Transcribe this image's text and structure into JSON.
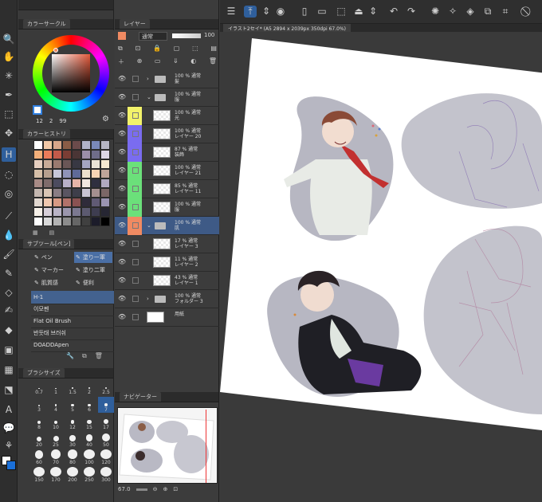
{
  "toolbar": {
    "icons": [
      "zoom-icon",
      "hand-icon",
      "sparkle-icon",
      "eyedropper-icon",
      "select-icon",
      "move-icon",
      "pen-icon",
      "lasso-icon",
      "spiral-icon",
      "dropper-icon",
      "blend-icon",
      "brush-icon",
      "eraser-icon",
      "pen2-icon",
      "fill-icon",
      "gradient-icon",
      "frame-icon",
      "shape-icon",
      "text-icon",
      "balloon-icon",
      "correct-icon"
    ]
  },
  "color_panel": {
    "title": "カラーサークル",
    "values": [
      "12",
      "2",
      "99"
    ],
    "main_color": "#f08a62",
    "sub_color": "#ffffff"
  },
  "history_panel": {
    "title": "カラーヒストリ",
    "swatches": [
      "#ffffff",
      "#f2c9a8",
      "#d8a78a",
      "#8a5d46",
      "#6b4b4b",
      "#b0b3c8",
      "#7a89b9",
      "#b7b6c4",
      "#f4b07a",
      "#ec7c5a",
      "#c25a4a",
      "#7a3d34",
      "#4a3535",
      "#9b8fa8",
      "#6f6d8a",
      "#dcd6e6",
      "#e6cfc0",
      "#c8aa98",
      "#9a7a70",
      "#6a5656",
      "#383843",
      "#a4a6c2",
      "#e9e3d6",
      "#f5e8d0",
      "#d6bfa8",
      "#b69f8e",
      "#c6c6d8",
      "#8f93b8",
      "#5f6a98",
      "#ece0cc",
      "#f7d4b4",
      "#bfa49a",
      "#a88b86",
      "#7f6b6b",
      "#4c4b5f",
      "#b8b0c9",
      "#e6b4a8",
      "#f2e7e0",
      "#2f2f3f",
      "#b1a9c0",
      "#c4b7b0",
      "#d9c5b5",
      "#8a7d84",
      "#5a5562",
      "#3e3e4a",
      "#c9c4d2",
      "#a48f8f",
      "#7b6767",
      "#e2d8d0",
      "#f0c8b0",
      "#d89a84",
      "#b2726a",
      "#8a5252",
      "#2f2b3a",
      "#605a74",
      "#9a94b2",
      "#f6f0e8",
      "#d7cfd8",
      "#bab4c6",
      "#9b96ad",
      "#7b7890",
      "#5c5a70",
      "#3e3d50",
      "#262633",
      "#ffffff",
      "#d9d9d9",
      "#b3b3b3",
      "#8c8c8c",
      "#666666",
      "#404040",
      "#1c1c2a",
      "#000000"
    ]
  },
  "subtool_panel": {
    "title": "サブツール[ペン]",
    "buttons": [
      {
        "label": "ペン",
        "active": false
      },
      {
        "label": "塗り一軍",
        "active": true
      },
      {
        "label": "マーカー",
        "active": false
      },
      {
        "label": "塗り二軍",
        "active": false
      },
      {
        "label": "肌質感",
        "active": false
      },
      {
        "label": "便利",
        "active": false
      }
    ],
    "brushes": [
      "H-1",
      "이모펜",
      "Flat Oil Brush",
      "반듯태 브러쉬",
      "DOADDApen"
    ],
    "active_brush": 0
  },
  "brush_size_panel": {
    "title": "ブラシサイズ",
    "sizes": [
      "0.7",
      "1",
      "1.5",
      "2",
      "2.5",
      "3",
      "4",
      "5",
      "6",
      "7",
      "8",
      "10",
      "12",
      "15",
      "17",
      "20",
      "25",
      "30",
      "40",
      "50",
      "60",
      "70",
      "80",
      "100",
      "120",
      "150",
      "170",
      "200",
      "250",
      "300"
    ],
    "active": "7"
  },
  "layer_panel": {
    "title": "レイヤー",
    "blend_mode": "通常",
    "opacity": "100",
    "layers": [
      {
        "line1": "100 % 通常",
        "line2": "髪",
        "kind": "folder",
        "color": ""
      },
      {
        "line1": "100 % 通常",
        "line2": "服",
        "kind": "folder-open",
        "color": ""
      },
      {
        "line1": "100 % 通常",
        "line2": "光",
        "kind": "layer",
        "color": "#f2f26a"
      },
      {
        "line1": "100 % 通常",
        "line2": "レイヤー 20",
        "kind": "layer",
        "color": "#7a6cf0"
      },
      {
        "line1": "87 % 通常",
        "line2": "装飾",
        "kind": "layer",
        "color": "#7a6cf0"
      },
      {
        "line1": "100 % 通常",
        "line2": "レイヤー 21",
        "kind": "layer",
        "color": "#6be07a"
      },
      {
        "line1": "85 % 通常",
        "line2": "レイヤー 11",
        "kind": "layer",
        "color": "#6be07a"
      },
      {
        "line1": "100 % 通常",
        "line2": "服",
        "kind": "layer",
        "color": "#6be07a"
      },
      {
        "line1": "100 % 通常",
        "line2": "肌",
        "kind": "folder-open",
        "color": "#f08a62",
        "selected": true
      },
      {
        "line1": "17 % 通常",
        "line2": "レイヤー 3",
        "kind": "layer",
        "color": ""
      },
      {
        "line1": "11 % 通常",
        "line2": "レイヤー 2",
        "kind": "layer",
        "color": ""
      },
      {
        "line1": "43 % 通常",
        "line2": "レイヤー 1",
        "kind": "layer",
        "color": ""
      },
      {
        "line1": "100 % 通常",
        "line2": "フォルダー 3",
        "kind": "folder",
        "color": ""
      },
      {
        "line1": "",
        "line2": "用紙",
        "kind": "paper",
        "color": ""
      }
    ]
  },
  "navigator": {
    "title": "ナビゲーター",
    "zoom": "67.0"
  },
  "canvas": {
    "tab_title": "イラスト2セイ* (A5 2894 x 2039px 350dpi 67.0%)"
  }
}
